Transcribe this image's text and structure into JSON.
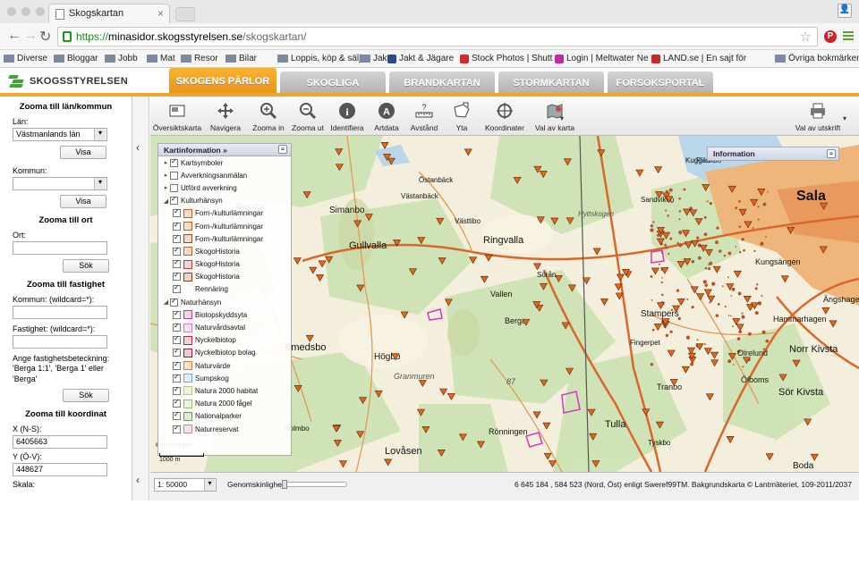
{
  "browser": {
    "tab_title": "Skogskartan",
    "url_scheme": "https://",
    "url_host": "minasidor.skogsstyrelsen.se",
    "url_path": "/skogskartan/",
    "bookmarks": [
      {
        "label": "Diverse",
        "icon": "folder-icon"
      },
      {
        "label": "Bloggar",
        "icon": "folder-icon"
      },
      {
        "label": "Jobb",
        "icon": "folder-icon"
      },
      {
        "label": "Mat",
        "icon": "folder-icon"
      },
      {
        "label": "Resor",
        "icon": "folder-icon"
      },
      {
        "label": "Bilar",
        "icon": "folder-icon"
      },
      {
        "label": "Loppis, köp & sälj",
        "icon": "folder-icon"
      },
      {
        "label": "Jakt",
        "icon": "folder-icon"
      },
      {
        "label": "Jakt & Jägare",
        "icon": "site-icon"
      },
      {
        "label": "Stock Photos | Shutt",
        "icon": "site-icon"
      },
      {
        "label": "Login | Meltwater Ne",
        "icon": "site-icon"
      },
      {
        "label": "LAND.se | En sajt för",
        "icon": "site-icon"
      },
      {
        "label": "Övriga bokmärken",
        "icon": "folder-icon"
      }
    ]
  },
  "site": {
    "logo_text": "SKOGSSTYRELSEN",
    "tabs": [
      {
        "label": "SKOGENS PÄRLOR",
        "active": true
      },
      {
        "label": "SKOGLIGA GRUNDDATA",
        "active": false
      },
      {
        "label": "BRANDKARTAN",
        "active": false
      },
      {
        "label": "STORMKARTAN",
        "active": false
      },
      {
        "label": "FÖRSÖKSPORTAL",
        "active": false
      }
    ]
  },
  "sidebar": {
    "section1_title": "Zooma till län/kommun",
    "lan_label": "Län:",
    "lan_value": "Västmanlands län",
    "visa1": "Visa",
    "kommun_label": "Kommun:",
    "kommun_value": "",
    "visa2": "Visa",
    "section2_title": "Zooma till ort",
    "ort_label": "Ort:",
    "ort_value": "",
    "sok1": "Sök",
    "section3_title": "Zooma till fastighet",
    "fast_kommun_label": "Kommun: (wildcard=*):",
    "fast_kommun_value": "",
    "fastighet_label": "Fastighet: (wildcard=*):",
    "fastighet_value": "",
    "hint": "Ange fastighetsbeteckning: 'Berga 1:1', 'Berga 1' eller 'Berga'",
    "sok2": "Sök",
    "section4_title": "Zooma till koordinat",
    "x_label": "X (N-S):",
    "x_value": "6405663",
    "y_label": "Y (Ö-V):",
    "y_value": "448627",
    "skala_label": "Skala:"
  },
  "map_tools": [
    {
      "label": "Översiktskarta",
      "icon": "overview-map-icon"
    },
    {
      "label": "Navigera",
      "icon": "pan-arrows-icon"
    },
    {
      "label": "Zooma in",
      "icon": "zoom-in-icon"
    },
    {
      "label": "Zooma ut",
      "icon": "zoom-out-icon"
    },
    {
      "label": "Identifiera",
      "icon": "info-icon"
    },
    {
      "label": "Artdata",
      "icon": "artdata-icon"
    },
    {
      "label": "Avstånd",
      "icon": "ruler-icon"
    },
    {
      "label": "Yta",
      "icon": "area-icon"
    },
    {
      "label": "Koordinater",
      "icon": "crosshair-icon"
    },
    {
      "label": "Val av karta",
      "icon": "map-select-icon"
    }
  ],
  "print_label": "Val av utskrift",
  "legend": {
    "title": "Kartinformation »",
    "rows": [
      {
        "label": "Kartsymboler",
        "level": 0,
        "toggle": "▸",
        "checked": true
      },
      {
        "label": "Avverkningsanmälan",
        "level": 0,
        "toggle": "▸",
        "checked": false
      },
      {
        "label": "Utförd avverkning",
        "level": 0,
        "toggle": "▸",
        "checked": false
      },
      {
        "label": "Kulturhänsyn",
        "level": 0,
        "toggle": "◢",
        "checked": true
      },
      {
        "label": "Forn-/kulturlämningar",
        "level": 1,
        "checked": true,
        "color": "#d25a1e"
      },
      {
        "label": "Forn-/kulturlämningar",
        "level": 1,
        "checked": true,
        "color": "#d25a1e"
      },
      {
        "label": "Forn-/kulturlämningar",
        "level": 1,
        "checked": true,
        "color": "#9a4a1a"
      },
      {
        "label": "SkogoHistoria",
        "level": 1,
        "checked": true,
        "color": "#d25a1e"
      },
      {
        "label": "SkogoHistoria",
        "level": 1,
        "checked": true,
        "color": "#c0392b"
      },
      {
        "label": "SkogoHistoria",
        "level": 1,
        "checked": true,
        "color": "#8b3a1a"
      },
      {
        "label": "Rennäring",
        "level": 1,
        "checked": true,
        "color": "#ffffff"
      },
      {
        "label": "Naturhänsyn",
        "level": 0,
        "toggle": "◢",
        "checked": true
      },
      {
        "label": "Biotopskyddsyta",
        "level": 1,
        "checked": true,
        "color": "#b03aa8"
      },
      {
        "label": "Naturvårdsavtal",
        "level": 1,
        "checked": true,
        "color": "#d27ac8"
      },
      {
        "label": "Nyckelbiotop",
        "level": 1,
        "checked": true,
        "color": "#c0203a"
      },
      {
        "label": "Nyckelbiotop bolag",
        "level": 1,
        "checked": true,
        "color": "#9a1a30"
      },
      {
        "label": "Naturvärde",
        "level": 1,
        "checked": true,
        "color": "#e07a2a"
      },
      {
        "label": "Sumpskog",
        "level": 1,
        "checked": true,
        "color": "#7aa6d6"
      },
      {
        "label": "Natura 2000 habitat",
        "level": 1,
        "checked": true,
        "color": "#b8c87a"
      },
      {
        "label": "Natura 2000 fågel",
        "level": 1,
        "checked": true,
        "color": "#9ab86a"
      },
      {
        "label": "Nationalparker",
        "level": 1,
        "checked": true,
        "color": "#6a9a4a"
      },
      {
        "label": "Naturreservat",
        "level": 1,
        "checked": true,
        "color": "#c08a9a"
      }
    ]
  },
  "info_panel_title": "Information",
  "scalebar_label": "1000 m",
  "places": [
    {
      "name": "Östanbäck"
    },
    {
      "name": "Västanbäck"
    },
    {
      "name": "Simanbo"
    },
    {
      "name": "Åkersbo"
    },
    {
      "name": "Västtibo"
    },
    {
      "name": "Gullvalla"
    },
    {
      "name": "Ringvalla"
    },
    {
      "name": "Vallen"
    },
    {
      "name": "Sörån"
    },
    {
      "name": "Berga"
    },
    {
      "name": "Smedsbo"
    },
    {
      "name": "Högbo"
    },
    {
      "name": "Granmuren"
    },
    {
      "name": "Rönningen"
    },
    {
      "name": "Lovåsen"
    },
    {
      "name": "Tulla"
    },
    {
      "name": "Tyskbo"
    },
    {
      "name": "Boda"
    },
    {
      "name": "Sör Kivsta"
    },
    {
      "name": "Norr Kivsta"
    },
    {
      "name": "Ölboms"
    },
    {
      "name": "Fingerpet"
    },
    {
      "name": "Stampers"
    },
    {
      "name": "Sandviken"
    },
    {
      "name": "Kungsängen"
    },
    {
      "name": "Sala"
    },
    {
      "name": "Hammarhagen"
    },
    {
      "name": "Ängshagen"
    },
    {
      "name": "Fläckbo"
    },
    {
      "name": "Hyttskogen"
    },
    {
      "name": "Kuggan"
    },
    {
      "name": "Olrelund"
    },
    {
      "name": "Tranbo"
    },
    {
      "name": "Holmbo"
    },
    {
      "name": "Heminningbo"
    },
    {
      "name": "87"
    }
  ],
  "statusbar": {
    "scale_value": "1: 50000",
    "opacity_label": "Genomskinlighet:",
    "coords_text": "6 645 184 , 584 523 (Nord, Öst) enligt Sweref99TM. Bakgrundskarta © Lantmäteriet, 109-2011/2037"
  }
}
